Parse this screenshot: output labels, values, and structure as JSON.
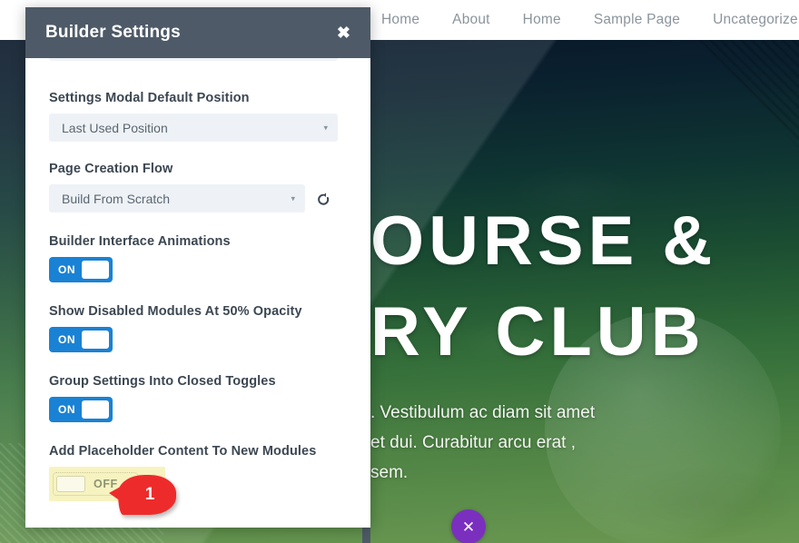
{
  "site": {
    "nav": [
      {
        "label": "Home"
      },
      {
        "label": "About"
      },
      {
        "label": "Home"
      },
      {
        "label": "Sample Page"
      },
      {
        "label": "Uncategorize"
      }
    ],
    "hero": {
      "title_line1": "OURSE &",
      "title_line2": "RY CLUB",
      "body_line1": ". Vestibulum ac diam sit amet",
      "body_line2": "et dui. Curabitur arcu erat ,",
      "body_line3": "sem."
    },
    "fab": {
      "icon": "close-icon",
      "glyph": "✕"
    }
  },
  "modal": {
    "title": "Builder Settings",
    "close_glyph": "✖",
    "fields": [
      {
        "label": "Settings Modal Default Position",
        "type": "select",
        "value": "Last Used Position",
        "caret": "▾"
      },
      {
        "label": "Page Creation Flow",
        "type": "select",
        "value": "Build From Scratch",
        "caret": "▾",
        "has_reset": true
      },
      {
        "label": "Builder Interface Animations",
        "type": "toggle",
        "state": "ON"
      },
      {
        "label": "Show Disabled Modules At 50% Opacity",
        "type": "toggle",
        "state": "ON"
      },
      {
        "label": "Group Settings Into Closed Toggles",
        "type": "toggle",
        "state": "ON"
      },
      {
        "label": "Add Placeholder Content To New Modules",
        "type": "toggle",
        "state": "OFF",
        "highlighted": true
      }
    ]
  },
  "annotation": {
    "step_number": "1"
  },
  "colors": {
    "modal_header": "#4e5a67",
    "toggle_on": "#1a82d4",
    "toggle_off_highlight": "#f7f3c0",
    "marker_red": "#ee2b2b",
    "fab_purple": "#7b2fbf",
    "select_background": "#eef2f6"
  }
}
